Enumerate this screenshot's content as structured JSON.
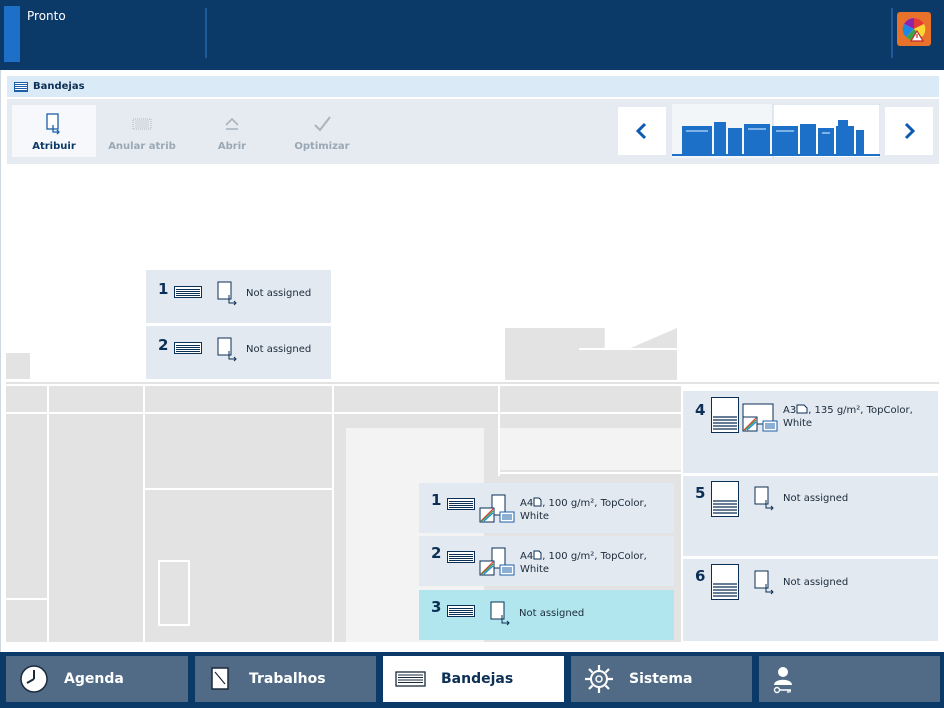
{
  "status": {
    "text": "Pronto"
  },
  "section": {
    "title": "Bandejas"
  },
  "toolbar": {
    "assign": "Atribuir",
    "unassign": "Anular atrib",
    "open": "Abrir",
    "optimize": "Optimizar"
  },
  "trays_top": [
    {
      "number": "1",
      "desc": "Not assigned"
    },
    {
      "number": "2",
      "desc": "Not assigned"
    }
  ],
  "trays_mid": [
    {
      "number": "1",
      "desc_line1": "A4",
      "desc_line1b": ", 100 g/m², TopColor,",
      "desc_line2": "White"
    },
    {
      "number": "2",
      "desc_line1": "A4",
      "desc_line1b": ", 100 g/m², TopColor,",
      "desc_line2": "White"
    },
    {
      "number": "3",
      "desc": "Not assigned",
      "selected": true
    }
  ],
  "trays_right": [
    {
      "number": "4",
      "desc_line1": "A3",
      "desc_line1b": ", 135 g/m², TopColor,",
      "desc_line2": "White"
    },
    {
      "number": "5",
      "desc": "Not assigned"
    },
    {
      "number": "6",
      "desc": "Not assigned"
    }
  ],
  "bottom_nav": {
    "agenda": "Agenda",
    "jobs": "Trabalhos",
    "trays": "Bandejas",
    "system": "Sistema"
  },
  "colors": {
    "accent": "#0b3a68",
    "selected_tray": "#b2e6ef",
    "tray_bg": "#e3e9f0"
  }
}
